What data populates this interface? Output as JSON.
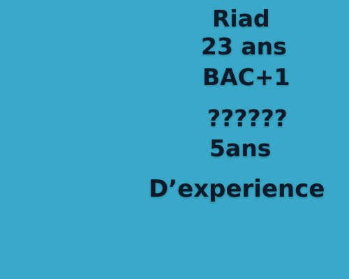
{
  "profile": {
    "name": "Riad",
    "age": "23 ans",
    "degree": "BAC+1",
    "unknown": "??????",
    "years": "5ans",
    "experience": "D’experience"
  },
  "colors": {
    "background": "#3aa8c8",
    "text": "#0c1a2a"
  }
}
